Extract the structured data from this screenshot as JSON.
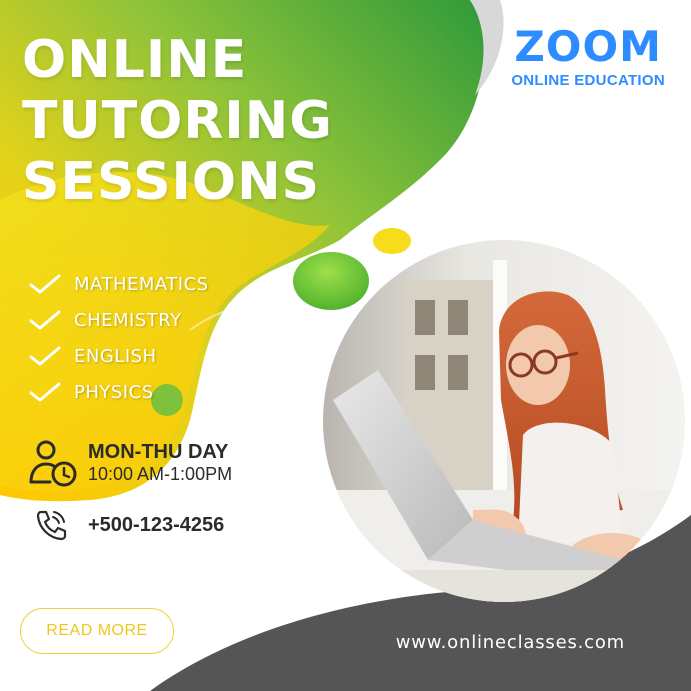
{
  "brand": {
    "logo_main": "ZOOM",
    "logo_sub": "ONLINE EDUCATION",
    "color": "#2d8cff"
  },
  "title": {
    "lines": [
      "ONLINE",
      "TUTORING",
      "SESSIONS"
    ]
  },
  "subjects": [
    "MATHEMATICS",
    "CHEMISTRY",
    "ENGLISH",
    "PHYSICS"
  ],
  "schedule": {
    "day": "MON-THU DAY",
    "time": "10:00 AM-1:00PM",
    "icon": "person-clock-icon"
  },
  "contact": {
    "phone": "+500-123-4256",
    "icon": "phone-icon"
  },
  "cta": {
    "label": "READ MORE"
  },
  "footer": {
    "website": "www.onlineclasses.com"
  },
  "colors": {
    "green": "#3aa63a",
    "yellow": "#f5d000",
    "dark_gray": "#555555",
    "accent_yellow": "#f0c61e"
  }
}
